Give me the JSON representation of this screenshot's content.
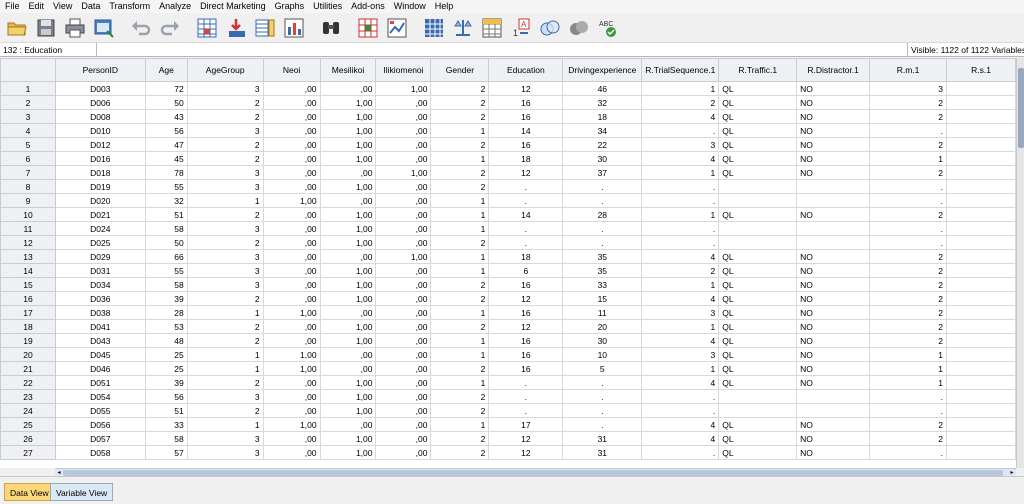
{
  "menu": [
    "File",
    "Edit",
    "View",
    "Data",
    "Transform",
    "Analyze",
    "Direct Marketing",
    "Graphs",
    "Utilities",
    "Add-ons",
    "Window",
    "Help"
  ],
  "editbar": {
    "cell_ref": "132 : Education",
    "cell_value": "",
    "visible": "Visible: 1122 of 1122 Variables"
  },
  "toolbar_icons": [
    "open-icon",
    "save-icon",
    "print-icon",
    "dialog-recall-icon",
    "undo-icon",
    "redo-icon",
    "goto-case-icon",
    "goto-variable-icon",
    "variables-icon",
    "run-descriptives-icon",
    "find-icon",
    "insert-cases-icon",
    "insert-variable-icon",
    "split-file-icon",
    "weight-cases-icon",
    "select-cases-icon",
    "value-labels-icon",
    "use-sets-icon",
    "show-all-variables-icon",
    "spell-check-icon"
  ],
  "columns": [
    "PersonID",
    "Age",
    "AgeGroup",
    "Neoi",
    "Mesilikoi",
    "Ilikiomenoi",
    "Gender",
    "Education",
    "Drivingexperience",
    "R.TrialSequence.1",
    "R.Traffic.1",
    "R.Distractor.1",
    "R.m.1",
    "R.s.1"
  ],
  "rows": [
    [
      "1",
      "D003",
      "72",
      "3",
      ",00",
      ",00",
      "1,00",
      "2",
      "12",
      "46",
      "1",
      "QL",
      "NO",
      "3",
      ""
    ],
    [
      "2",
      "D006",
      "50",
      "2",
      ",00",
      "1,00",
      ",00",
      "2",
      "16",
      "32",
      "2",
      "QL",
      "NO",
      "2",
      ""
    ],
    [
      "3",
      "D008",
      "43",
      "2",
      ",00",
      "1,00",
      ",00",
      "2",
      "16",
      "18",
      "4",
      "QL",
      "NO",
      "2",
      ""
    ],
    [
      "4",
      "D010",
      "56",
      "3",
      ",00",
      "1,00",
      ",00",
      "1",
      "14",
      "34",
      ".",
      "QL",
      "NO",
      ".",
      ""
    ],
    [
      "5",
      "D012",
      "47",
      "2",
      ",00",
      "1,00",
      ",00",
      "2",
      "16",
      "22",
      "3",
      "QL",
      "NO",
      "2",
      ""
    ],
    [
      "6",
      "D016",
      "45",
      "2",
      ",00",
      "1,00",
      ",00",
      "1",
      "18",
      "30",
      "4",
      "QL",
      "NO",
      "1",
      ""
    ],
    [
      "7",
      "D018",
      "78",
      "3",
      ",00",
      ",00",
      "1,00",
      "2",
      "12",
      "37",
      "1",
      "QL",
      "NO",
      "2",
      ""
    ],
    [
      "8",
      "D019",
      "55",
      "3",
      ",00",
      "1,00",
      ",00",
      "2",
      ".",
      ".",
      ".",
      "",
      "",
      ".",
      ""
    ],
    [
      "9",
      "D020",
      "32",
      "1",
      "1,00",
      ",00",
      ",00",
      "1",
      ".",
      ".",
      ".",
      "",
      "",
      ".",
      ""
    ],
    [
      "10",
      "D021",
      "51",
      "2",
      ",00",
      "1,00",
      ",00",
      "1",
      "14",
      "28",
      "1",
      "QL",
      "NO",
      "2",
      ""
    ],
    [
      "11",
      "D024",
      "58",
      "3",
      ",00",
      "1,00",
      ",00",
      "1",
      ".",
      ".",
      ".",
      "",
      "",
      ".",
      ""
    ],
    [
      "12",
      "D025",
      "50",
      "2",
      ",00",
      "1,00",
      ",00",
      "2",
      ".",
      ".",
      ".",
      "",
      "",
      ".",
      ""
    ],
    [
      "13",
      "D029",
      "66",
      "3",
      ",00",
      ",00",
      "1,00",
      "1",
      "18",
      "35",
      "4",
      "QL",
      "NO",
      "2",
      ""
    ],
    [
      "14",
      "D031",
      "55",
      "3",
      ",00",
      "1,00",
      ",00",
      "1",
      "6",
      "35",
      "2",
      "QL",
      "NO",
      "2",
      ""
    ],
    [
      "15",
      "D034",
      "58",
      "3",
      ",00",
      "1,00",
      ",00",
      "2",
      "16",
      "33",
      "1",
      "QL",
      "NO",
      "2",
      ""
    ],
    [
      "16",
      "D036",
      "39",
      "2",
      ",00",
      "1,00",
      ",00",
      "2",
      "12",
      "15",
      "4",
      "QL",
      "NO",
      "2",
      ""
    ],
    [
      "17",
      "D038",
      "28",
      "1",
      "1,00",
      ",00",
      ",00",
      "1",
      "16",
      "11",
      "3",
      "QL",
      "NO",
      "2",
      ""
    ],
    [
      "18",
      "D041",
      "53",
      "2",
      ",00",
      "1,00",
      ",00",
      "2",
      "12",
      "20",
      "1",
      "QL",
      "NO",
      "2",
      ""
    ],
    [
      "19",
      "D043",
      "48",
      "2",
      ",00",
      "1,00",
      ",00",
      "1",
      "16",
      "30",
      "4",
      "QL",
      "NO",
      "2",
      ""
    ],
    [
      "20",
      "D045",
      "25",
      "1",
      "1,00",
      ",00",
      ",00",
      "1",
      "16",
      "10",
      "3",
      "QL",
      "NO",
      "1",
      ""
    ],
    [
      "21",
      "D046",
      "25",
      "1",
      "1,00",
      ",00",
      ",00",
      "2",
      "16",
      "5",
      "1",
      "QL",
      "NO",
      "1",
      ""
    ],
    [
      "22",
      "D051",
      "39",
      "2",
      ",00",
      "1,00",
      ",00",
      "1",
      ".",
      ".",
      "4",
      "QL",
      "NO",
      "1",
      ""
    ],
    [
      "23",
      "D054",
      "56",
      "3",
      ",00",
      "1,00",
      ",00",
      "2",
      ".",
      ".",
      ".",
      "",
      "",
      ".",
      ""
    ],
    [
      "24",
      "D055",
      "51",
      "2",
      ",00",
      "1,00",
      ",00",
      "2",
      ".",
      ".",
      ".",
      "",
      "",
      ".",
      ""
    ],
    [
      "25",
      "D056",
      "33",
      "1",
      "1,00",
      ",00",
      ",00",
      "1",
      "17",
      ".",
      "4",
      "QL",
      "NO",
      "2",
      ""
    ],
    [
      "26",
      "D057",
      "58",
      "3",
      ",00",
      "1,00",
      ",00",
      "2",
      "12",
      "31",
      "4",
      "QL",
      "NO",
      "2",
      ""
    ],
    [
      "27",
      "D058",
      "57",
      "3",
      ",00",
      "1,00",
      ",00",
      "2",
      "12",
      "31",
      ".",
      "QL",
      "NO",
      ".",
      ""
    ]
  ],
  "tabs": {
    "data_view": "Data View",
    "variable_view": "Variable View"
  }
}
